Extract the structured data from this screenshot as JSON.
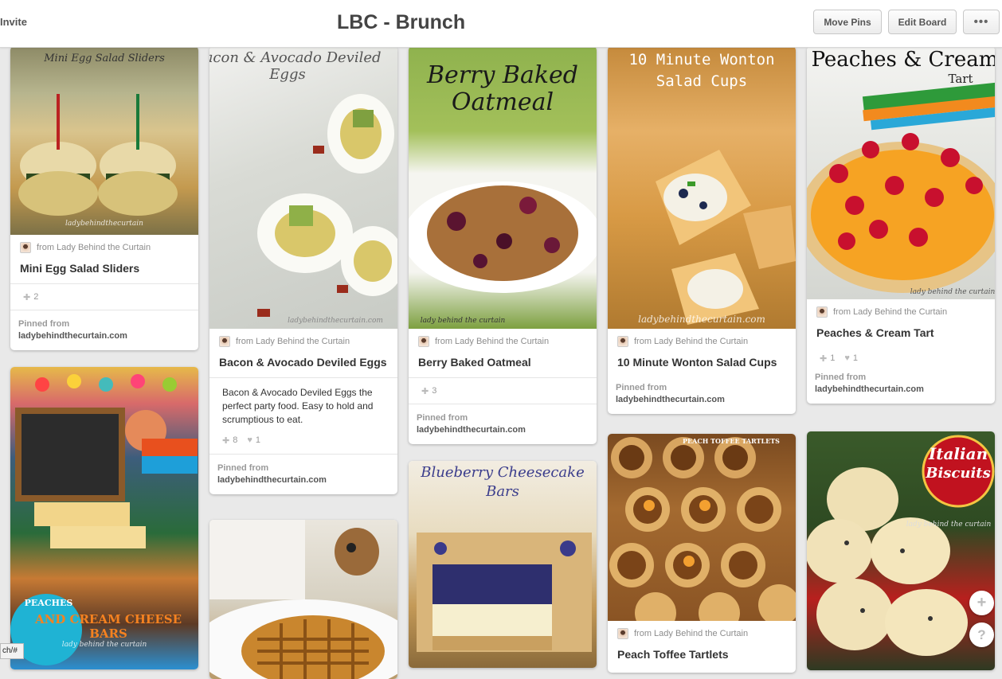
{
  "header": {
    "invite_label": "Invite",
    "board_title": "LBC - Brunch",
    "move_pins_label": "Move Pins",
    "edit_board_label": "Edit Board",
    "more_label": "•••"
  },
  "pins": [
    {
      "image_text": "Mini Egg Salad Sliders",
      "watermark": "ladybehindthecurtain",
      "source": "from Lady Behind the Curtain",
      "title": "Mini Egg Salad Sliders",
      "repins": "2",
      "pinned_from_label": "Pinned from",
      "pinned_from_domain": "ladybehindthecurtain.com"
    },
    {
      "image_text": "Bacon & Avocado Deviled Eggs",
      "watermark": "ladybehindthecurtain.com",
      "source": "from Lady Behind the Curtain",
      "title": "Bacon & Avocado Deviled Eggs",
      "description": "Bacon & Avocado Deviled Eggs the perfect party food.  Easy to hold and scrumptious to eat.",
      "repins": "8",
      "likes": "1",
      "pinned_from_label": "Pinned from",
      "pinned_from_domain": "ladybehindthecurtain.com"
    },
    {
      "image_text": "Berry Baked Oatmeal",
      "watermark": "lady behind the curtain",
      "source": "from Lady Behind the Curtain",
      "title": "Berry Baked Oatmeal",
      "repins": "3",
      "pinned_from_label": "Pinned from",
      "pinned_from_domain": "ladybehindthecurtain.com"
    },
    {
      "image_text": "10 Minute Wonton Salad Cups",
      "watermark": "ladybehindthecurtain.com",
      "source": "from Lady Behind the Curtain",
      "title": "10 Minute Wonton Salad Cups",
      "pinned_from_label": "Pinned from",
      "pinned_from_domain": "ladybehindthecurtain.com"
    },
    {
      "image_text_1": "Peaches & Cream",
      "image_text_2": "Tart",
      "watermark": "lady behind the curtain",
      "source": "from Lady Behind the Curtain",
      "title": "Peaches & Cream Tart",
      "repins": "1",
      "likes": "1",
      "pinned_from_label": "Pinned from",
      "pinned_from_domain": "ladybehindthecurtain.com"
    },
    {
      "image_text_1": "PEACHES",
      "image_text_2": "AND CREAM CHEESE BARS",
      "watermark": "lady behind the curtain"
    },
    {
      "image_text": ""
    },
    {
      "image_text_1": "Blueberry Cheesecake",
      "image_text_2": "Bars"
    },
    {
      "image_text": "PEACH TOFFEE TARTLETS",
      "source": "from Lady Behind the Curtain",
      "title": "Peach Toffee Tartlets"
    },
    {
      "image_text_1": "Italian",
      "image_text_2": "Biscuits",
      "watermark": "lady behind the curtain"
    }
  ],
  "fab": {
    "add_label": "+",
    "help_label": "?"
  },
  "statusbar": {
    "text": "ch/#"
  },
  "colors": {
    "background": "#e9e9e9",
    "card": "#ffffff",
    "title_text": "#444444"
  }
}
